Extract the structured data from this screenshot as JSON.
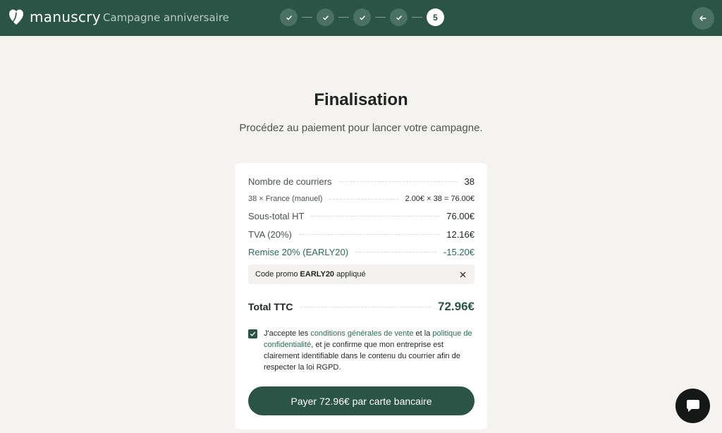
{
  "header": {
    "brand": "manuscry",
    "campaign": "Campagne anniversaire",
    "steps": [
      {
        "icon": "check-icon",
        "done": true
      },
      {
        "icon": "check-icon",
        "done": true
      },
      {
        "icon": "check-icon",
        "done": true
      },
      {
        "icon": "check-icon",
        "done": true
      },
      {
        "label": "5",
        "done": false
      }
    ],
    "back_icon": "arrow-left-icon"
  },
  "main": {
    "title": "Finalisation",
    "subtitle": "Procédez au paiement pour lancer votre campagne."
  },
  "summary": {
    "count_label": "Nombre de courriers",
    "count_value": "38",
    "line_label": "38 × France (manuel)",
    "line_value": "2.00€ × 38 = 76.00€",
    "subtotal_label": "Sous-total HT",
    "subtotal_value": "76.00€",
    "tva_label": "TVA (20%)",
    "tva_value": "12.16€",
    "discount_label": "Remise 20% (EARLY20)",
    "discount_value": "-15.20€",
    "promo_prefix": "Code promo",
    "promo_code": "EARLY20",
    "promo_suffix": "appliqué",
    "total_label": "Total TTC",
    "total_value": "72.96€"
  },
  "consent": {
    "checked": true,
    "text_1": "J'accepte les ",
    "link_cgv": "conditions générales de vente",
    "text_2": " et la ",
    "link_privacy": "politique de confidentialité",
    "text_3": ", et je confirme que mon entreprise est clairement identifiable dans le contenu du courrier afin de respecter la loi RGPD."
  },
  "pay_button": "Payer 72.96€ par carte bancaire",
  "colors": {
    "brand": "#2a5446",
    "accent_text": "#2d6a55",
    "background": "#f4f3ef"
  }
}
